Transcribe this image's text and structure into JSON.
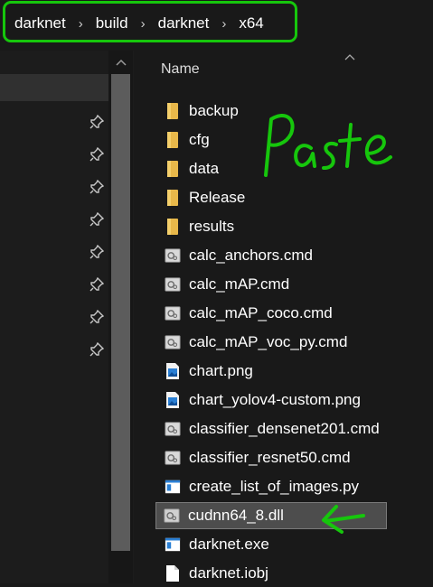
{
  "breadcrumb": [
    "darknet",
    "build",
    "darknet",
    "x64"
  ],
  "breadcrumb_separator": "›",
  "header": {
    "name_column": "Name"
  },
  "files": [
    {
      "name": "backup",
      "icon": "folder-icon"
    },
    {
      "name": "cfg",
      "icon": "folder-icon"
    },
    {
      "name": "data",
      "icon": "folder-icon"
    },
    {
      "name": "Release",
      "icon": "folder-icon"
    },
    {
      "name": "results",
      "icon": "folder-icon"
    },
    {
      "name": "calc_anchors.cmd",
      "icon": "cmd-file-icon"
    },
    {
      "name": "calc_mAP.cmd",
      "icon": "cmd-file-icon"
    },
    {
      "name": "calc_mAP_coco.cmd",
      "icon": "cmd-file-icon"
    },
    {
      "name": "calc_mAP_voc_py.cmd",
      "icon": "cmd-file-icon"
    },
    {
      "name": "chart.png",
      "icon": "image-file-icon"
    },
    {
      "name": "chart_yolov4-custom.png",
      "icon": "image-file-icon"
    },
    {
      "name": "classifier_densenet201.cmd",
      "icon": "cmd-file-icon"
    },
    {
      "name": "classifier_resnet50.cmd",
      "icon": "cmd-file-icon"
    },
    {
      "name": "create_list_of_images.py",
      "icon": "py-file-icon"
    },
    {
      "name": "cudnn64_8.dll",
      "icon": "dll-file-icon",
      "selected": true
    },
    {
      "name": "darknet.exe",
      "icon": "exe-file-icon"
    },
    {
      "name": "darknet.iobj",
      "icon": "generic-file-icon"
    }
  ],
  "annotation": {
    "text": "Paste",
    "color": "#16c60c"
  },
  "colors": {
    "background": "#191919",
    "selection": "#4d4d4d",
    "folder": "#e8b84a",
    "highlight": "#16c60c"
  }
}
